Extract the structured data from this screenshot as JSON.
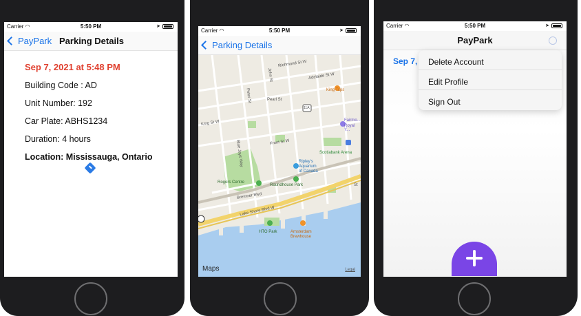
{
  "statusbar": {
    "carrier": "Carrier",
    "time": "5:50 PM"
  },
  "screen1": {
    "back_label": "PayPark",
    "title": "Parking Details",
    "date": "Sep 7, 2021 at 5:48 PM",
    "building": "Building Code : AD",
    "unit": "Unit Number: 192",
    "plate": "Car Plate: ABHS1234",
    "duration": "Duration: 4 hours",
    "location": "Location: Mississauga, Ontario"
  },
  "screen2": {
    "back_label": "Parking Details",
    "map": {
      "logo": "Maps",
      "legal": "Legal",
      "labels": {
        "richmond": "Richmond St W",
        "adelaide": "Adelaide St W",
        "king_taps": "King Taps",
        "pearl": "Pearl St",
        "king": "King St W",
        "fairmont": "Fairmo...",
        "royal": "Royal Y...",
        "front": "Front St W",
        "scotiabank": "Scotiabank Arena",
        "ripleys": "Ripley's",
        "aquarium": "Aquarium",
        "of_canada": "of Canada",
        "rogers": "Rogers Centre",
        "roundhouse": "Roundhouse Park",
        "bremner": "Bremner Blvd",
        "lakeshore": "Lake Shore Blvd W",
        "hto": "HTO Park",
        "amsterdam": "Amsterdam",
        "brewhouse": "Brewhouse",
        "highway": "11A",
        "peter": "Peter St",
        "john": "John St",
        "blue_jays": "Blue Jays Way",
        "st": "St"
      }
    }
  },
  "screen3": {
    "title": "PayPark",
    "visible_date": "Sep 7,",
    "menu": [
      "Delete Account",
      "Edit Profile",
      "Sign Out"
    ]
  },
  "colors": {
    "accent": "#1a73e8",
    "date_red": "#e0402f",
    "fab_purple": "#7a45e6"
  }
}
